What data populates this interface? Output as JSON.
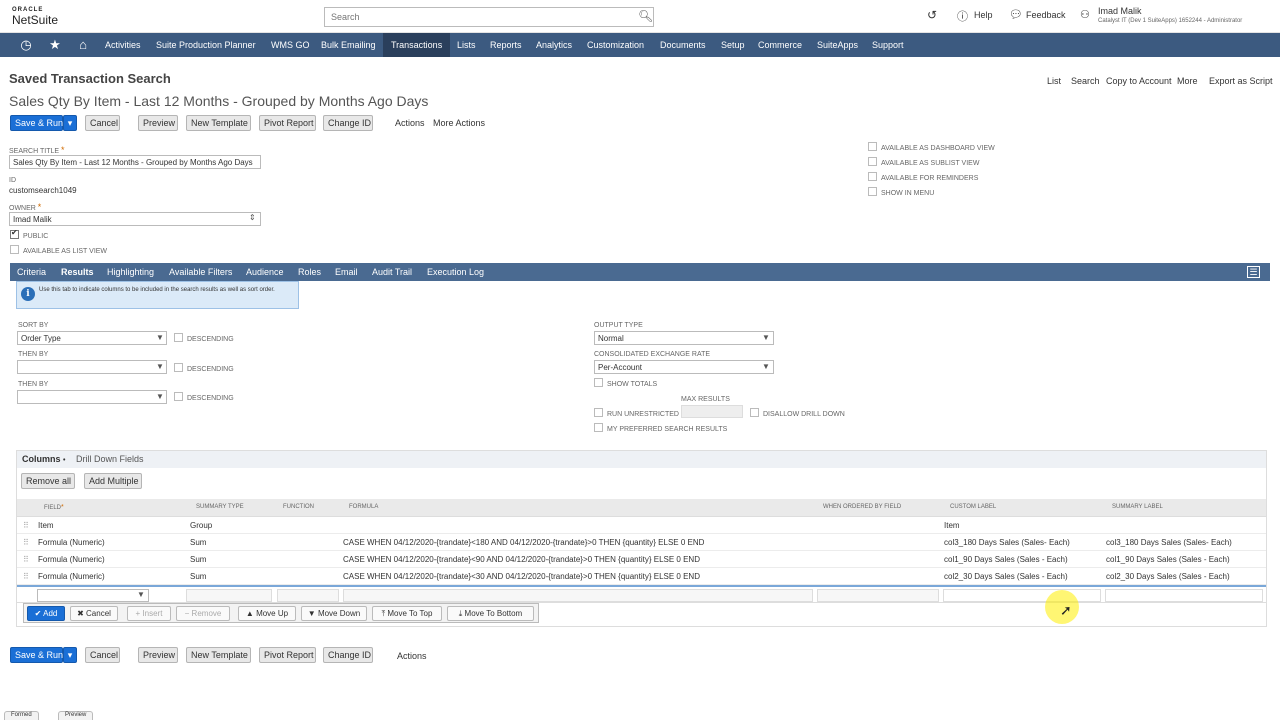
{
  "topbar": {
    "logo_top": "ORACLE",
    "logo_bottom": "NetSuite",
    "search_placeholder": "Search",
    "help": "Help",
    "feedback": "Feedback",
    "user_name": "Imad Malik",
    "user_account": "Catalyst IT (Dev 1 SuiteApps) 1652244 - Administrator"
  },
  "nav": {
    "items": [
      "Activities",
      "Suite Production Planner",
      "WMS GO",
      "Bulk Emailing",
      "Transactions",
      "Lists",
      "Reports",
      "Analytics",
      "Customization",
      "Documents",
      "Setup",
      "Commerce",
      "SuiteApps",
      "Support"
    ],
    "selected": "Transactions"
  },
  "page": {
    "heading": "Saved Transaction Search",
    "title": "Sales Qty By Item - Last 12 Months - Grouped by Months Ago Days",
    "right_links": [
      "List",
      "Search",
      "Copy to Account",
      "More",
      "Export as Script"
    ]
  },
  "toolbar": {
    "save_run": "Save & Run",
    "cancel": "Cancel",
    "preview": "Preview",
    "new_template": "New Template",
    "pivot_report": "Pivot Report",
    "change_id": "Change ID",
    "actions": "Actions",
    "more_actions": "More Actions"
  },
  "form": {
    "search_title_label": "SEARCH TITLE",
    "search_title_value": "Sales Qty By Item - Last 12 Months - Grouped by Months Ago Days",
    "id_label": "ID",
    "id_value": "customsearch1049",
    "owner_label": "OWNER",
    "owner_value": "Imad Malik",
    "public_label": "PUBLIC",
    "public_checked": true,
    "available_list_label": "AVAILABLE AS LIST VIEW",
    "right_checks": [
      "AVAILABLE AS DASHBOARD VIEW",
      "AVAILABLE AS SUBLIST VIEW",
      "AVAILABLE FOR REMINDERS",
      "SHOW IN MENU"
    ]
  },
  "tabs": {
    "items": [
      "Criteria",
      "Results",
      "Highlighting",
      "Available Filters",
      "Audience",
      "Roles",
      "Email",
      "Audit Trail",
      "Execution Log"
    ],
    "selected": "Results"
  },
  "info_text": "Use this tab to indicate columns to be included in the search results as well as sort order.",
  "results": {
    "sort_by_label": "SORT BY",
    "sort_by_value": "Order Type",
    "then_by_label": "THEN BY",
    "descending_label": "DESCENDING",
    "output_type_label": "OUTPUT TYPE",
    "output_type_value": "Normal",
    "exchange_rate_label": "CONSOLIDATED EXCHANGE RATE",
    "exchange_rate_value": "Per-Account",
    "show_totals": "SHOW TOTALS",
    "max_results": "MAX RESULTS",
    "run_unrestricted": "RUN UNRESTRICTED",
    "disallow_drill": "DISALLOW DRILL DOWN",
    "my_preferred": "MY PREFERRED SEARCH RESULTS"
  },
  "columns": {
    "subtab_columns": "Columns",
    "subtab_drill": "Drill Down Fields",
    "remove_all": "Remove all",
    "add_multiple": "Add Multiple",
    "headers": [
      "FIELD",
      "SUMMARY TYPE",
      "FUNCTION",
      "FORMULA",
      "WHEN ORDERED BY FIELD",
      "CUSTOM LABEL",
      "SUMMARY LABEL"
    ],
    "rows": [
      {
        "field": "Item",
        "summary": "Group",
        "function": "",
        "formula": "",
        "ordered": "",
        "custom": "Item",
        "summary_label": ""
      },
      {
        "field": "Formula (Numeric)",
        "summary": "Sum",
        "function": "",
        "formula": "CASE WHEN 04/12/2020-{trandate}<180 AND 04/12/2020-{trandate}>0 THEN {quantity} ELSE 0 END",
        "ordered": "",
        "custom": "col3_180 Days Sales (Sales- Each)",
        "summary_label": "col3_180 Days Sales (Sales- Each)"
      },
      {
        "field": "Formula (Numeric)",
        "summary": "Sum",
        "function": "",
        "formula": "CASE WHEN 04/12/2020-{trandate}<90 AND 04/12/2020-{trandate}>0 THEN {quantity} ELSE 0 END",
        "ordered": "",
        "custom": "col1_90 Days Sales (Sales - Each)",
        "summary_label": "col1_90 Days Sales (Sales - Each)"
      },
      {
        "field": "Formula (Numeric)",
        "summary": "Sum",
        "function": "",
        "formula": "CASE WHEN 04/12/2020-{trandate}<30 AND 04/12/2020-{trandate}>0 THEN {quantity} ELSE 0 END",
        "ordered": "",
        "custom": "col2_30 Days Sales (Sales - Each)",
        "summary_label": "col2_30 Days Sales (Sales - Each)"
      }
    ],
    "actions": {
      "add": "Add",
      "cancel": "Cancel",
      "insert": "Insert",
      "remove": "Remove",
      "move_up": "Move Up",
      "move_down": "Move Down",
      "move_top": "Move To Top",
      "move_bottom": "Move To Bottom"
    }
  },
  "bottom_tabs": [
    "Formed",
    "Preview"
  ],
  "colors": {
    "nav": "#3c5a80",
    "nav_selected": "#2a3f5c",
    "primary": "#1a6fd6",
    "tabs": "#4a6a91"
  }
}
